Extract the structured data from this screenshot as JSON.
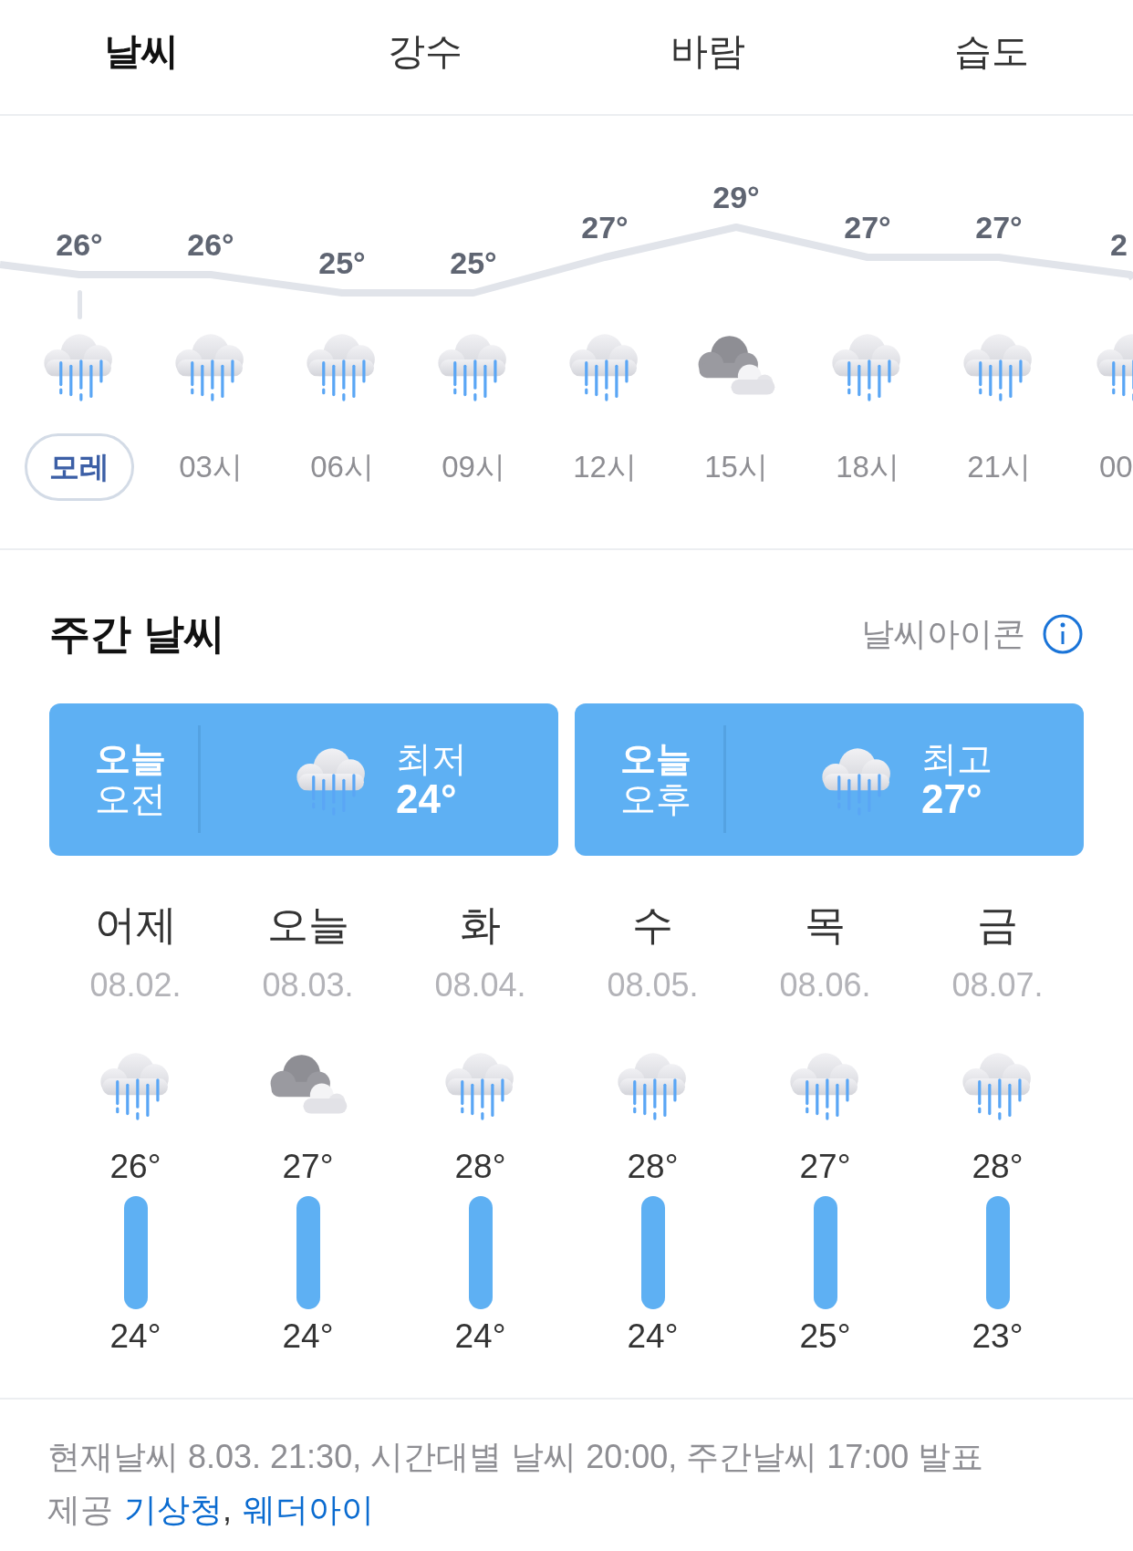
{
  "tabs": [
    {
      "label": "날씨",
      "selected": true
    },
    {
      "label": "강수",
      "selected": false
    },
    {
      "label": "바람",
      "selected": false
    },
    {
      "label": "습도",
      "selected": false
    }
  ],
  "hourly": [
    {
      "temp": "26°",
      "time": "모레",
      "kind": "rain",
      "selected": true
    },
    {
      "temp": "26°",
      "time": "03시",
      "kind": "rain",
      "selected": false
    },
    {
      "temp": "25°",
      "time": "06시",
      "kind": "rain",
      "selected": false
    },
    {
      "temp": "25°",
      "time": "09시",
      "kind": "rain",
      "selected": false
    },
    {
      "temp": "27°",
      "time": "12시",
      "kind": "rain",
      "selected": false
    },
    {
      "temp": "29°",
      "time": "15시",
      "kind": "cloudy",
      "selected": false
    },
    {
      "temp": "27°",
      "time": "18시",
      "kind": "rain",
      "selected": false
    },
    {
      "temp": "27°",
      "time": "21시",
      "kind": "rain",
      "selected": false
    },
    {
      "temp": "2",
      "time": "00",
      "kind": "rain",
      "selected": false
    }
  ],
  "weekly": {
    "title": "주간 날씨",
    "icon_link": "날씨아이콘",
    "cards": [
      {
        "day": "오늘",
        "period": "오전",
        "kind": "rain",
        "label": "최저",
        "temp": "24°"
      },
      {
        "day": "오늘",
        "period": "오후",
        "kind": "rain",
        "label": "최고",
        "temp": "27°"
      }
    ],
    "days": [
      {
        "day": "어제",
        "date": "08.02.",
        "kind": "rain",
        "high": "26°",
        "low": "24°"
      },
      {
        "day": "오늘",
        "date": "08.03.",
        "kind": "cloudy",
        "high": "27°",
        "low": "24°"
      },
      {
        "day": "화",
        "date": "08.04.",
        "kind": "rain",
        "high": "28°",
        "low": "24°"
      },
      {
        "day": "수",
        "date": "08.05.",
        "kind": "rain",
        "high": "28°",
        "low": "24°"
      },
      {
        "day": "목",
        "date": "08.06.",
        "kind": "rain",
        "high": "27°",
        "low": "25°"
      },
      {
        "day": "금",
        "date": "08.07.",
        "kind": "rain",
        "high": "28°",
        "low": "23°"
      }
    ]
  },
  "footer": {
    "notice": "현재날씨 8.03. 21:30, 시간대별 날씨 20:00, 주간날씨 17:00 발표",
    "provider_label": "제공",
    "providers": [
      "기상청",
      "웨더아이"
    ],
    "separator": ","
  }
}
